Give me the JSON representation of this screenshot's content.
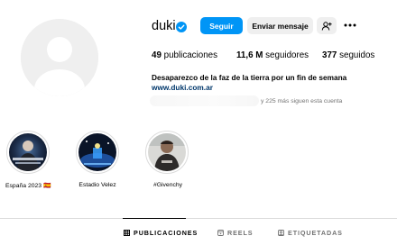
{
  "profile": {
    "username": "duki",
    "verified_icon": "verified-badge-icon",
    "bio": "Desaparezco de la faz de la tierra por un fin de semana",
    "link": "www.duki.com.ar",
    "followed_by_more": "y 225 más siguen esta cuenta"
  },
  "actions": {
    "follow_label": "Seguir",
    "message_label": "Enviar mensaje",
    "suggest_icon": "add-person-icon",
    "more_icon": "more-options-icon"
  },
  "stats": {
    "posts_count": "49",
    "posts_label": "publicaciones",
    "followers_count": "11,6 M",
    "followers_label": "seguidores",
    "following_count": "377",
    "following_label": "seguidos"
  },
  "highlights": [
    {
      "label": "España 2023 🇪🇸"
    },
    {
      "label": "Estadio Velez"
    },
    {
      "label": "#Givenchy"
    }
  ],
  "tabs": [
    {
      "label": "PUBLICACIONES",
      "icon": "grid-icon",
      "active": true
    },
    {
      "label": "REELS",
      "icon": "reels-icon",
      "active": false
    },
    {
      "label": "ETIQUETADAS",
      "icon": "tagged-icon",
      "active": false
    }
  ],
  "colors": {
    "accent": "#0095f6",
    "link": "#00376b",
    "secondary_text": "#737373",
    "button_gray": "#efefef",
    "border": "#dbdbdb"
  }
}
